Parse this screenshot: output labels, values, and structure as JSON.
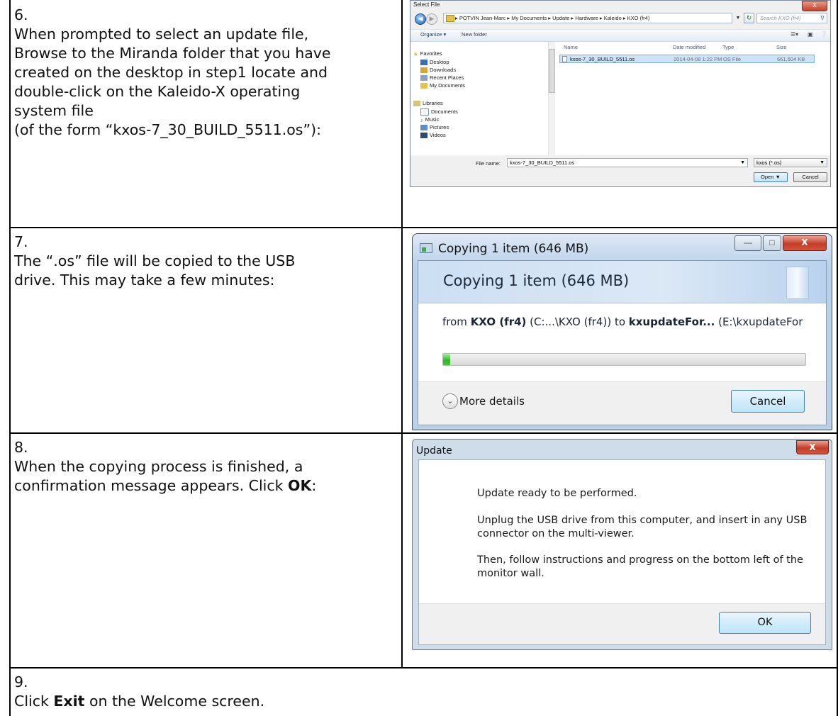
{
  "steps": [
    {
      "number": "6.",
      "lines": [
        "When prompted to select an update file,",
        "Browse to the Miranda folder that you have",
        "created on the desktop in step1 locate and",
        "double-click on the Kaleido-X operating",
        "system file",
        "(of the form “kxos-7_30_BUILD_5511.os”):"
      ]
    },
    {
      "number": "7.",
      "lines": [
        "The “.os” file will be copied to the USB",
        "drive. This may take a few minutes:"
      ]
    },
    {
      "number": "8.",
      "line1": "When the copying process is finished, a",
      "line2_prefix": "confirmation message appears. Click ",
      "line2_bold": "OK",
      "line2_suffix": ":"
    },
    {
      "number": "9.",
      "line_prefix": "Click ",
      "line_bold": "Exit",
      "line_suffix": " on the Welcome screen."
    }
  ],
  "select_file": {
    "title": "Select File",
    "close_label": "X",
    "address": "▸ POTVIN Jean-Marc ▸ My Documents ▸ Update ▸ Hardware ▸ Kaleido ▸ KXO (fr4)",
    "search_placeholder": "Search KXO (fr4)",
    "toolbar": {
      "organize": "Organize ▾",
      "new_folder": "New folder"
    },
    "nav": {
      "favorites": "Favorites",
      "desktop": "Desktop",
      "downloads": "Downloads",
      "recent": "Recent Places",
      "my_documents": "My Documents",
      "libraries": "Libraries",
      "documents": "Documents",
      "music": "Music",
      "pictures": "Pictures",
      "videos": "Videos"
    },
    "columns": {
      "name": "Name",
      "date": "Date modified",
      "type": "Type",
      "size": "Size"
    },
    "file": {
      "name": "kxos-7_30_BUILD_5511.os",
      "date": "2014-04-08 1:22 PM",
      "type": "OS File",
      "size": "661,504 KB"
    },
    "file_name_label": "File name:",
    "file_name_value": "kxos-7_30_BUILD_5511.os",
    "file_type": "kxos (*.os)",
    "open_label": "Open",
    "cancel_label": "Cancel"
  },
  "copy_dialog": {
    "title": "Copying 1 item (646 MB)",
    "heading": "Copying 1 item (646 MB)",
    "from_prefix": "from ",
    "from_bold": "KXO (fr4)",
    "from_mid": " (C:...\\KXO (fr4)) to ",
    "to_bold": "kxupdateFor...",
    "to_suffix": " (E:\\kxupdateFor",
    "progress_percent": 2,
    "more_details": "More details",
    "cancel_label": "Cancel",
    "minimize_label": "—",
    "maximize_label": "□",
    "close_label": "X"
  },
  "update_dialog": {
    "title": "Update",
    "close_label": "X",
    "msg1": "Update ready to be performed.",
    "msg2": "Unplug the USB drive from this computer, and insert in any USB connector on the multi-viewer.",
    "msg3": "Then, follow instructions and progress on the bottom left of the monitor wall.",
    "ok_label": "OK"
  }
}
